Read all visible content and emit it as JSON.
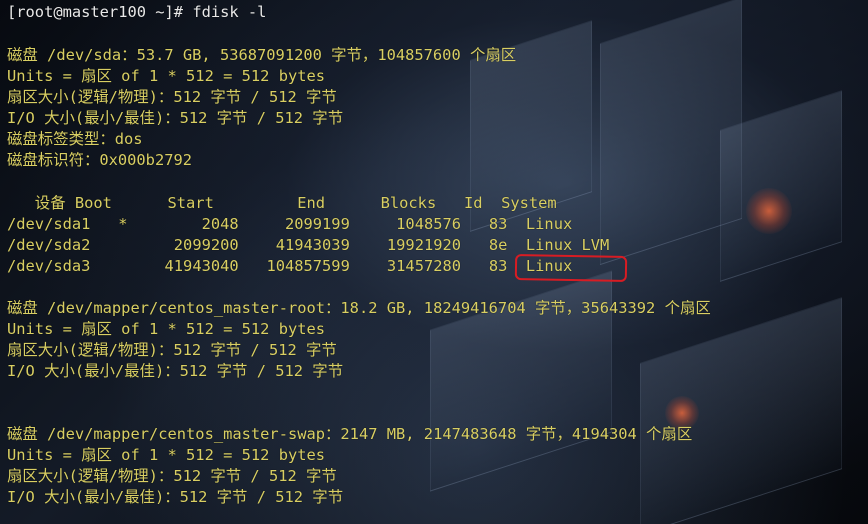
{
  "terminal": {
    "prompt": "[root@master100 ~]# fdisk -l",
    "lines": [
      "磁盘 /dev/sda：53.7 GB, 53687091200 字节，104857600 个扇区",
      "Units = 扇区 of 1 * 512 = 512 bytes",
      "扇区大小(逻辑/物理)：512 字节 / 512 字节",
      "I/O 大小(最小/最佳)：512 字节 / 512 字节",
      "磁盘标签类型：dos",
      "磁盘标识符：0x000b2792",
      "   设备 Boot      Start         End      Blocks   Id  System",
      "/dev/sda1   *        2048     2099199     1048576   83  Linux",
      "/dev/sda2         2099200    41943039    19921920   8e  Linux LVM",
      "/dev/sda3        41943040   104857599    31457280   83  Linux",
      "磁盘 /dev/mapper/centos_master-root：18.2 GB, 18249416704 字节，35643392 个扇区",
      "Units = 扇区 of 1 * 512 = 512 bytes",
      "扇区大小(逻辑/物理)：512 字节 / 512 字节",
      "I/O 大小(最小/最佳)：512 字节 / 512 字节",
      "磁盘 /dev/mapper/centos_master-swap：2147 MB, 2147483648 字节，4194304 个扇区",
      "Units = 扇区 of 1 * 512 = 512 bytes",
      "扇区大小(逻辑/物理)：512 字节 / 512 字节",
      "I/O 大小(最小/最佳)：512 字节 / 512 字节"
    ]
  },
  "colors": {
    "output_text": "#d9cf63",
    "prompt_text": "#e9e9e9",
    "annotation": "#d81c23"
  }
}
